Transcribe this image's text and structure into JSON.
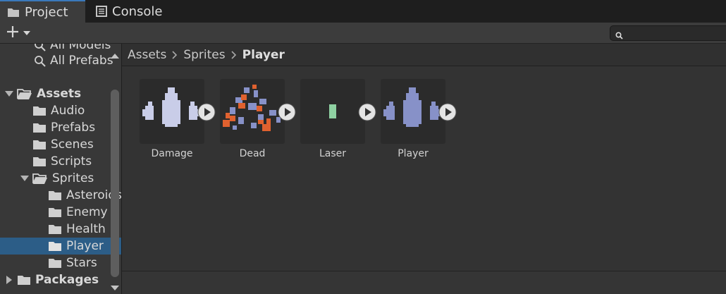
{
  "tabs": [
    {
      "label": "Project",
      "icon": "folder-icon",
      "active": true
    },
    {
      "label": "Console",
      "icon": "console-icon",
      "active": false
    }
  ],
  "toolbar": {
    "add_icon": "plus-icon",
    "dropdown_icon": "chevron-down-icon"
  },
  "search": {
    "placeholder": "",
    "value": ""
  },
  "tree": {
    "search_items": [
      "All Models",
      "All Prefabs"
    ],
    "assets_label": "Assets",
    "assets_children": [
      "Audio",
      "Prefabs",
      "Scenes",
      "Scripts"
    ],
    "sprites_label": "Sprites",
    "sprites_children": [
      "Asteroids",
      "Enemy",
      "Health",
      "Player",
      "Stars"
    ],
    "selected": "Player",
    "packages_label": "Packages"
  },
  "breadcrumb": [
    "Assets",
    "Sprites",
    "Player"
  ],
  "assets": [
    {
      "name": "Damage"
    },
    {
      "name": "Dead"
    },
    {
      "name": "Laser"
    },
    {
      "name": "Player"
    }
  ],
  "colors": {
    "accent": "#3a79bb",
    "selection": "#2c5d87",
    "ship_light": "#c9cde8",
    "ship": "#8791c8",
    "dead_orange": "#e0612f",
    "laser": "#8fd1a2"
  }
}
